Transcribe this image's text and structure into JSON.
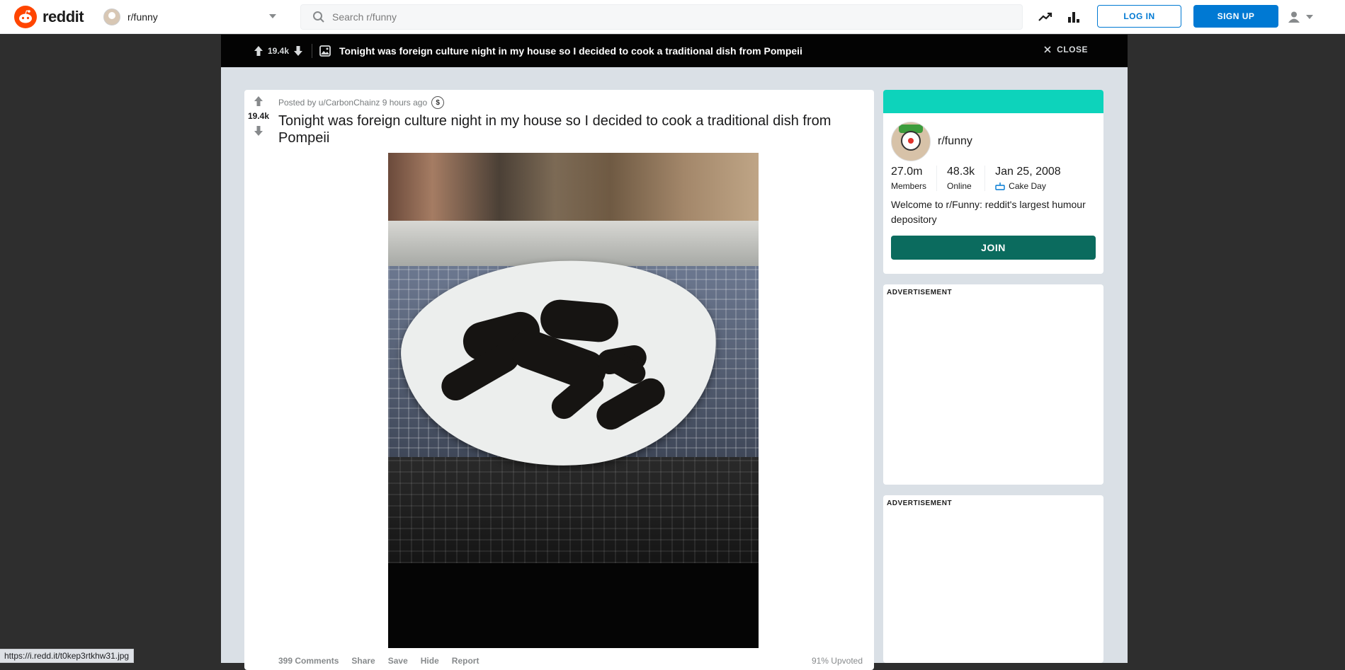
{
  "header": {
    "brand": "reddit",
    "community": "r/funny",
    "search_placeholder": "Search r/funny",
    "login_label": "LOG IN",
    "signup_label": "SIGN UP"
  },
  "post_bar": {
    "score": "19.4k",
    "title": "Tonight was foreign culture night in my house so I decided to cook a traditional dish from Pompeii",
    "close_label": "CLOSE"
  },
  "post": {
    "score": "19.4k",
    "meta": "Posted by u/CarbonChainz 9 hours ago",
    "title": "Tonight was foreign culture night in my house so I decided to cook a traditional dish from Pompeii",
    "actions": [
      "399 Comments",
      "Share",
      "Save",
      "Hide",
      "Report"
    ],
    "upvoted": "91% Upvoted"
  },
  "sidebar": {
    "name": "r/funny",
    "members_value": "27.0m",
    "members_label": "Members",
    "online_value": "48.3k",
    "online_label": "Online",
    "cake_value": "Jan 25, 2008",
    "cake_label": "Cake Day",
    "description": "Welcome to r/Funny: reddit's largest humour depository",
    "join_label": "JOIN",
    "ad_label": "ADVERTISEMENT"
  },
  "status_url": "https://i.redd.it/t0kep3rtkhw31.jpg",
  "colors": {
    "brand": "#ff4500",
    "primary_blue": "#0079d3",
    "banner": "#0dd3bb",
    "join": "#0b6b5e"
  }
}
